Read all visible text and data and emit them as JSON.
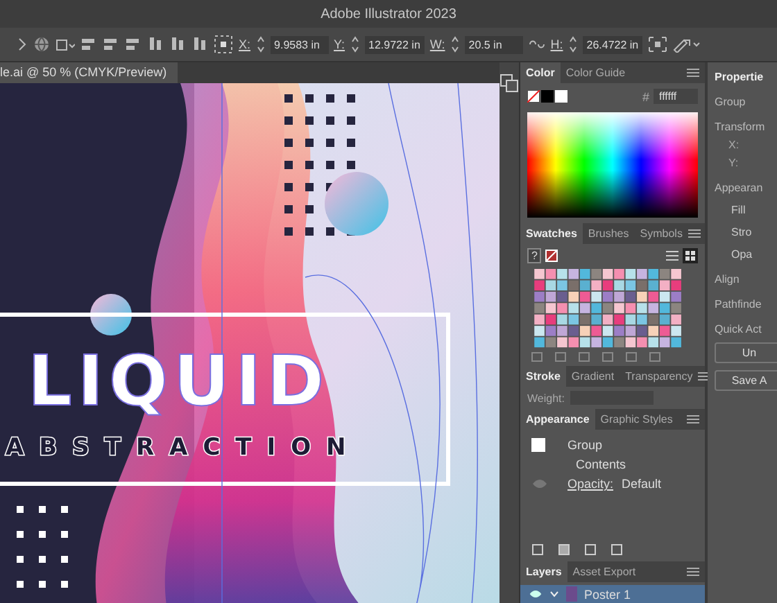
{
  "window": {
    "title": "Adobe Illustrator 2023"
  },
  "control_bar": {
    "fields": [
      {
        "label": "X:",
        "value": "9.9583 in"
      },
      {
        "label": "Y:",
        "value": "12.9722 in"
      },
      {
        "label": "W:",
        "value": "20.5 in"
      },
      {
        "label": "H:",
        "value": "26.4722 in"
      }
    ]
  },
  "document_tab": {
    "title": "le.ai @ 50 % (CMYK/Preview)"
  },
  "artwork": {
    "title": "LIQUID",
    "subtitle": "ABSTRACTION"
  },
  "color_panel": {
    "tabs": [
      {
        "label": "Color",
        "selected": true
      },
      {
        "label": "Color Guide",
        "selected": false
      }
    ],
    "hex_label": "#",
    "hex": "ffffff"
  },
  "swatches_panel": {
    "tabs": [
      {
        "label": "Swatches",
        "selected": true
      },
      {
        "label": "Brushes",
        "selected": false
      },
      {
        "label": "Symbols",
        "selected": false
      }
    ],
    "fill_label": "?"
  },
  "stroke_panel": {
    "tabs": [
      {
        "label": "Stroke",
        "selected": true
      },
      {
        "label": "Gradient",
        "selected": false
      },
      {
        "label": "Transparency",
        "selected": false
      }
    ],
    "weight_label": "Weight:"
  },
  "appearance_panel": {
    "tabs": [
      {
        "label": "Appearance",
        "selected": true
      },
      {
        "label": "Graphic Styles",
        "selected": false
      }
    ],
    "rows": [
      {
        "kind": "header",
        "label": "Group"
      },
      {
        "kind": "contents",
        "label": "Contents"
      },
      {
        "kind": "attribute",
        "label": "Opacity:",
        "value": "Default"
      }
    ]
  },
  "layers_panel": {
    "tabs": [
      {
        "label": "Layers",
        "selected": true
      },
      {
        "label": "Asset Export",
        "selected": false
      }
    ],
    "layers": [
      {
        "name": "Poster 1",
        "expanded": true
      }
    ]
  },
  "properties_panel": {
    "items": [
      {
        "kind": "title",
        "text": "Propertie"
      },
      {
        "kind": "label",
        "text": "Group"
      },
      {
        "kind": "heading",
        "text": "Transform"
      },
      {
        "kind": "coord",
        "text": "X:"
      },
      {
        "kind": "coord",
        "text": "Y:"
      },
      {
        "kind": "heading",
        "text": "Appearan"
      },
      {
        "kind": "row",
        "text": "Fill"
      },
      {
        "kind": "row",
        "text": "Stro"
      },
      {
        "kind": "row",
        "text": "Opa"
      },
      {
        "kind": "heading",
        "text": "Align"
      },
      {
        "kind": "heading",
        "text": "Pathfinde"
      },
      {
        "kind": "heading",
        "text": "Quick Act"
      },
      {
        "kind": "button",
        "text": "Un"
      },
      {
        "kind": "button",
        "text": "Save A"
      }
    ]
  }
}
